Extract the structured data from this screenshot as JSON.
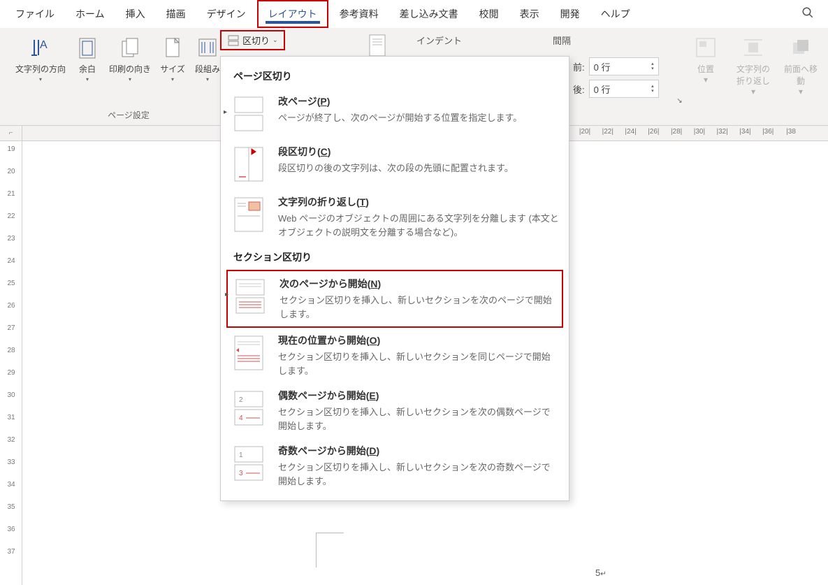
{
  "tabs": [
    "ファイル",
    "ホーム",
    "挿入",
    "描画",
    "デザイン",
    "レイアウト",
    "参考資料",
    "差し込み文書",
    "校閲",
    "表示",
    "開発",
    "ヘルプ"
  ],
  "active_tab_index": 5,
  "ribbon": {
    "text_direction": "文字列の方向",
    "margins": "余白",
    "orientation": "印刷の向き",
    "size": "サイズ",
    "columns": "段組み",
    "page_setup_label": "ページ設定",
    "breaks": "区切り",
    "indent_label": "インデント",
    "spacing_label": "間隔",
    "before_label": "前:",
    "before_value": "0 行",
    "after_label": "後:",
    "after_value": "0 行",
    "position": "位置",
    "wrap_text": "文字列の折り返し",
    "bring_forward": "前面へ移動"
  },
  "dropdown": {
    "section1_title": "ページ区切り",
    "items1": [
      {
        "title": "改ページ(",
        "hotkey": "P",
        "title_end": ")",
        "desc": "ページが終了し、次のページが開始する位置を指定します。"
      },
      {
        "title": "段区切り(",
        "hotkey": "C",
        "title_end": ")",
        "desc": "段区切りの後の文字列は、次の段の先頭に配置されます。"
      },
      {
        "title": "文字列の折り返し(",
        "hotkey": "T",
        "title_end": ")",
        "desc": "Web ページのオブジェクトの周囲にある文字列を分離します (本文とオブジェクトの説明文を分離する場合など)。"
      }
    ],
    "section2_title": "セクション区切り",
    "items2": [
      {
        "title": "次のページから開始(",
        "hotkey": "N",
        "title_end": ")",
        "desc": "セクション区切りを挿入し、新しいセクションを次のページで開始します。",
        "highlighted": true
      },
      {
        "title": "現在の位置から開始(",
        "hotkey": "O",
        "title_end": ")",
        "desc": "セクション区切りを挿入し、新しいセクションを同じページで開始します。"
      },
      {
        "title": "偶数ページから開始(",
        "hotkey": "E",
        "title_end": ")",
        "desc": "セクション区切りを挿入し、新しいセクションを次の偶数ページで開始します。"
      },
      {
        "title": "奇数ページから開始(",
        "hotkey": "D",
        "title_end": ")",
        "desc": "セクション区切りを挿入し、新しいセクションを次の奇数ページで開始します。"
      }
    ]
  },
  "h_ruler_marks": [
    "|20|",
    "|22|",
    "|24|",
    "|26|",
    "|28|",
    "|30|",
    "|32|",
    "|34|",
    "|36|",
    "|38"
  ],
  "v_ruler_marks": [
    "19",
    "20",
    "21",
    "22",
    "23",
    "24",
    "25",
    "26",
    "27",
    "28",
    "29",
    "30",
    "31",
    "32",
    "33",
    "34",
    "35",
    "36",
    "37"
  ],
  "page_number": "5",
  "page_number_symbol": "↵",
  "corner_ruler_symbol": "⌐"
}
